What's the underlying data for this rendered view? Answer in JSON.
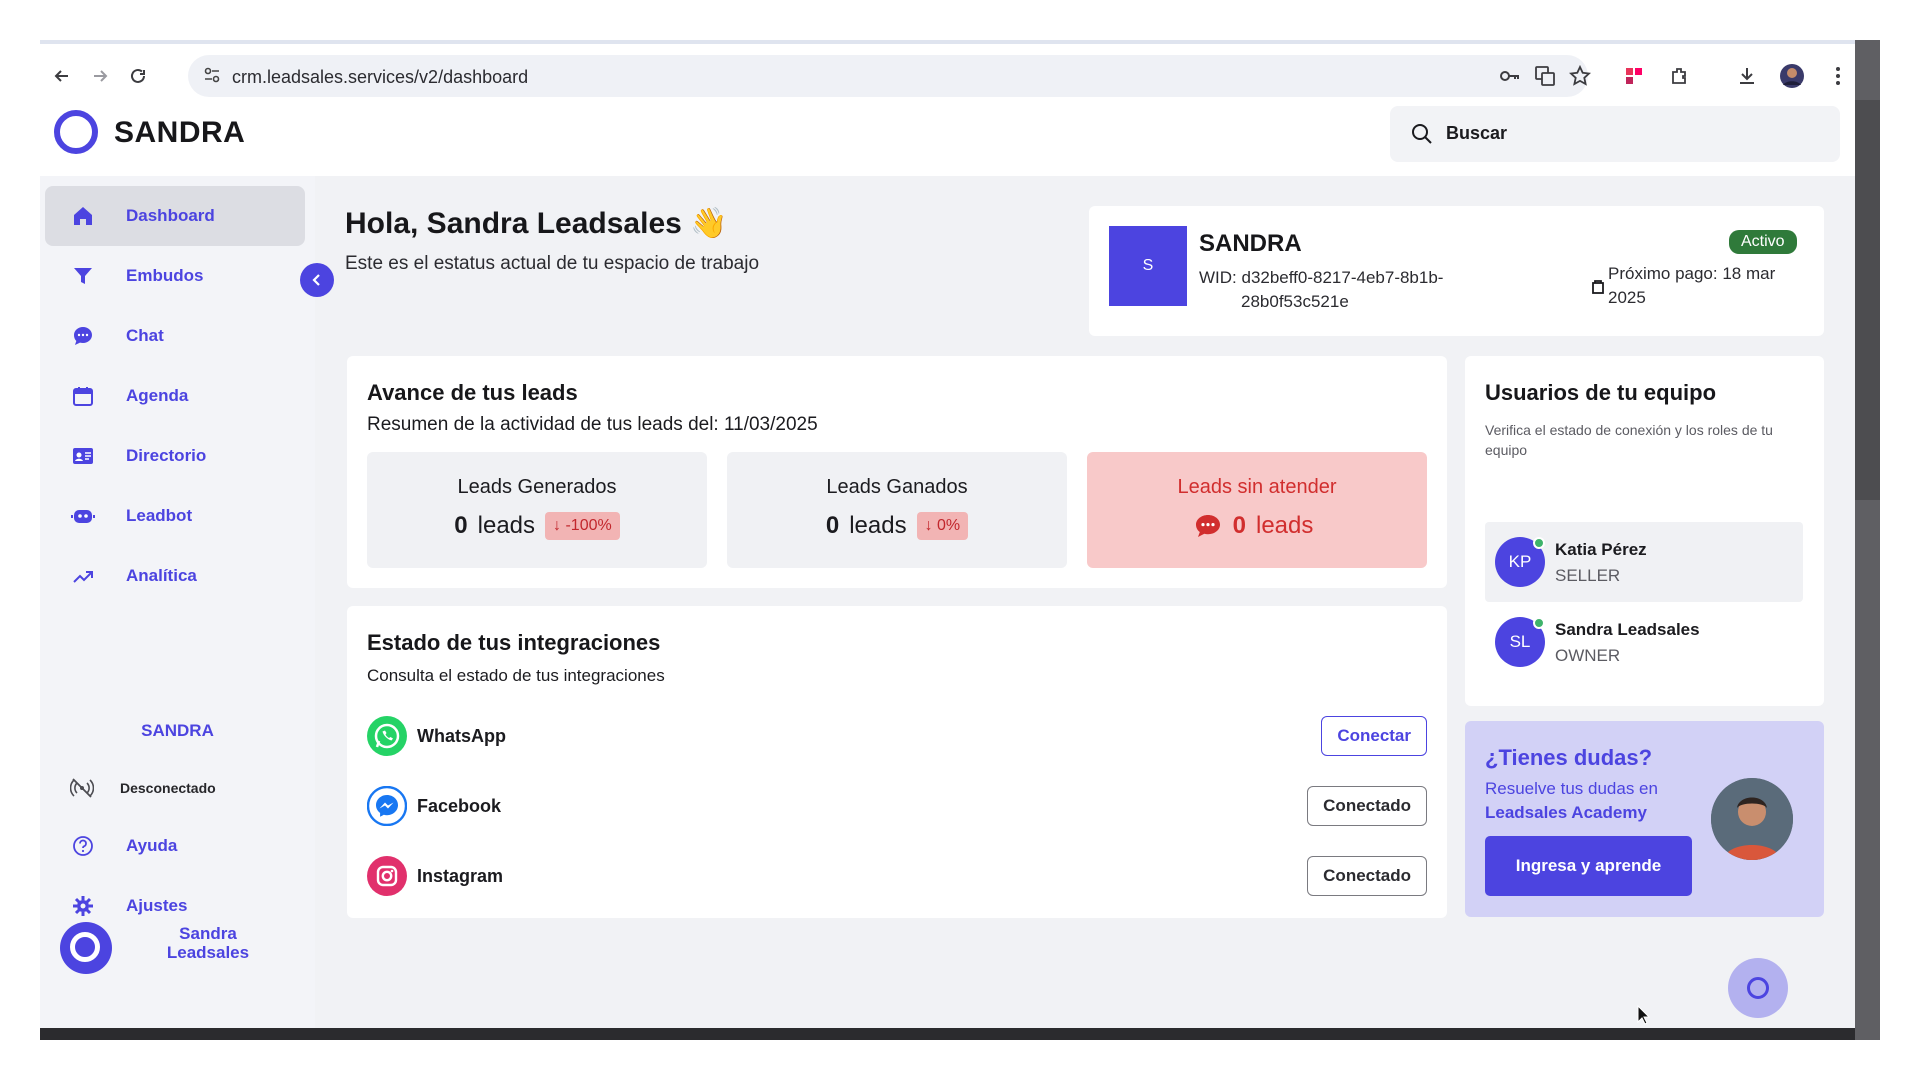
{
  "browser": {
    "url": "crm.leadsales.services/v2/dashboard"
  },
  "app": {
    "brand": "SANDRA",
    "search_label": "Buscar"
  },
  "sidebar": {
    "items": [
      {
        "label": "Dashboard",
        "icon": "home-icon"
      },
      {
        "label": "Embudos",
        "icon": "funnel-icon"
      },
      {
        "label": "Chat",
        "icon": "chat-bubble-icon"
      },
      {
        "label": "Agenda",
        "icon": "calendar-icon"
      },
      {
        "label": "Directorio",
        "icon": "contact-card-icon"
      },
      {
        "label": "Leadbot",
        "icon": "bot-icon"
      },
      {
        "label": "Analítica",
        "icon": "trend-up-icon"
      }
    ],
    "workspace_name": "SANDRA",
    "bottom_items": [
      {
        "label": "Desconectado",
        "icon": "signal-off-icon"
      },
      {
        "label": "Ayuda",
        "icon": "help-circle-icon"
      },
      {
        "label": "Ajustes",
        "icon": "gear-icon"
      }
    ],
    "user_name": "Sandra Leadsales"
  },
  "main": {
    "greeting": "Hola, Sandra Leadsales 👋",
    "greeting_sub": "Este es el estatus actual de tu espacio de trabajo"
  },
  "workspace_card": {
    "avatar_letter": "S",
    "name": "SANDRA",
    "wid_line1": "WID: d32beff0-8217-4eb7-8b1b-",
    "wid_line2": "28b0f53c521e",
    "status": "Activo",
    "next_payment_line1": "Próximo pago: 18 mar",
    "next_payment_line2": "2025"
  },
  "leads": {
    "title": "Avance de tus leads",
    "subtitle": "Resumen de la actividad de tus leads del: 11/03/2025",
    "generated": {
      "title": "Leads Generados",
      "value": "0",
      "unit": "leads",
      "change": "↓ -100%"
    },
    "won": {
      "title": "Leads Ganados",
      "value": "0",
      "unit": "leads",
      "change": "↓ 0%"
    },
    "unattended": {
      "title": "Leads sin atender",
      "value": "0",
      "unit": "leads"
    }
  },
  "integrations": {
    "title": "Estado de tus integraciones",
    "subtitle": "Consulta el estado de tus integraciones",
    "items": [
      {
        "name": "WhatsApp",
        "action": "Conectar",
        "color": "#25d366"
      },
      {
        "name": "Facebook",
        "action": "Conectado",
        "color": "#1877f2"
      },
      {
        "name": "Instagram",
        "action": "Conectado",
        "color": "#e1306c"
      }
    ]
  },
  "team": {
    "title": "Usuarios de tu equipo",
    "subtitle": "Verifica el estado de conexión y los roles de tu equipo",
    "members": [
      {
        "initials": "KP",
        "name": "Katia Pérez",
        "role": "SELLER"
      },
      {
        "initials": "SL",
        "name": "Sandra Leadsales",
        "role": "OWNER"
      }
    ]
  },
  "help": {
    "title": "¿Tienes dudas?",
    "line1": "Resuelve tus dudas en",
    "line2": "Leadsales Academy",
    "button": "Ingresa y aprende"
  },
  "colors": {
    "accent": "#4c44e0",
    "danger": "#d12e2e",
    "active_badge": "#2f7a3a"
  }
}
